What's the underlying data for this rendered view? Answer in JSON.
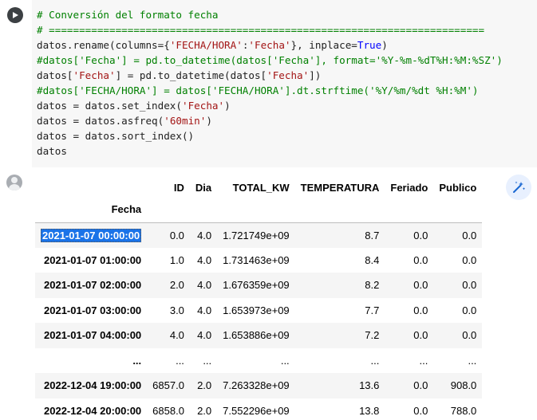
{
  "code": {
    "lines": [
      [
        {
          "t": "# Conversión del formato fecha",
          "c": "c-comment"
        }
      ],
      [
        {
          "t": "# ========================================================================",
          "c": "c-comment"
        }
      ],
      [
        {
          "t": "datos.rename(columns={",
          "c": ""
        },
        {
          "t": "'FECHA/HORA'",
          "c": "c-str"
        },
        {
          "t": ":",
          "c": ""
        },
        {
          "t": "'Fecha'",
          "c": "c-str"
        },
        {
          "t": "}, inplace=",
          "c": ""
        },
        {
          "t": "True",
          "c": "c-kw"
        },
        {
          "t": ")",
          "c": ""
        }
      ],
      [
        {
          "t": "#datos['Fecha'] = pd.to_datetime(datos['Fecha'], format='%Y-%m-%dT%H:%M:%SZ')",
          "c": "c-comment"
        }
      ],
      [
        {
          "t": "datos[",
          "c": ""
        },
        {
          "t": "'Fecha'",
          "c": "c-str"
        },
        {
          "t": "] = pd.to_datetime(datos[",
          "c": ""
        },
        {
          "t": "'Fecha'",
          "c": "c-str"
        },
        {
          "t": "])",
          "c": ""
        }
      ],
      [
        {
          "t": "#datos['FECHA/HORA'] = datos['FECHA/HORA'].dt.strftime('%Y/%m/%dt %H:%M')",
          "c": "c-comment"
        }
      ],
      [
        {
          "t": "datos = datos.set_index(",
          "c": ""
        },
        {
          "t": "'Fecha'",
          "c": "c-str"
        },
        {
          "t": ")",
          "c": ""
        }
      ],
      [
        {
          "t": "datos = datos.asfreq(",
          "c": ""
        },
        {
          "t": "'60min'",
          "c": "c-str"
        },
        {
          "t": ")",
          "c": ""
        }
      ],
      [
        {
          "t": "datos = datos.sort_index()",
          "c": ""
        }
      ],
      [
        {
          "t": "datos",
          "c": ""
        }
      ]
    ]
  },
  "table": {
    "columns": [
      "ID",
      "Dia",
      "TOTAL_KW",
      "TEMPERATURA",
      "Feriado",
      "Publico"
    ],
    "index_name": "Fecha",
    "rows": [
      {
        "index": "2021-01-07 00:00:00",
        "values": [
          "0.0",
          "4.0",
          "1.721749e+09",
          "8.7",
          "0.0",
          "0.0"
        ],
        "selected": true
      },
      {
        "index": "2021-01-07 01:00:00",
        "values": [
          "1.0",
          "4.0",
          "1.731463e+09",
          "8.4",
          "0.0",
          "0.0"
        ]
      },
      {
        "index": "2021-01-07 02:00:00",
        "values": [
          "2.0",
          "4.0",
          "1.676359e+09",
          "8.2",
          "0.0",
          "0.0"
        ]
      },
      {
        "index": "2021-01-07 03:00:00",
        "values": [
          "3.0",
          "4.0",
          "1.653973e+09",
          "7.7",
          "0.0",
          "0.0"
        ]
      },
      {
        "index": "2021-01-07 04:00:00",
        "values": [
          "4.0",
          "4.0",
          "1.653886e+09",
          "7.2",
          "0.0",
          "0.0"
        ]
      },
      {
        "index": "...",
        "values": [
          "...",
          "...",
          "...",
          "...",
          "...",
          "..."
        ]
      },
      {
        "index": "2022-12-04 19:00:00",
        "values": [
          "6857.0",
          "2.0",
          "7.263328e+09",
          "13.6",
          "0.0",
          "908.0"
        ]
      },
      {
        "index": "2022-12-04 20:00:00",
        "values": [
          "6858.0",
          "2.0",
          "7.552296e+09",
          "13.8",
          "0.0",
          "788.0"
        ]
      }
    ]
  },
  "icons": {
    "run": "play-icon",
    "avatar": "user-avatar-icon",
    "magic": "magic-wand-icon"
  }
}
